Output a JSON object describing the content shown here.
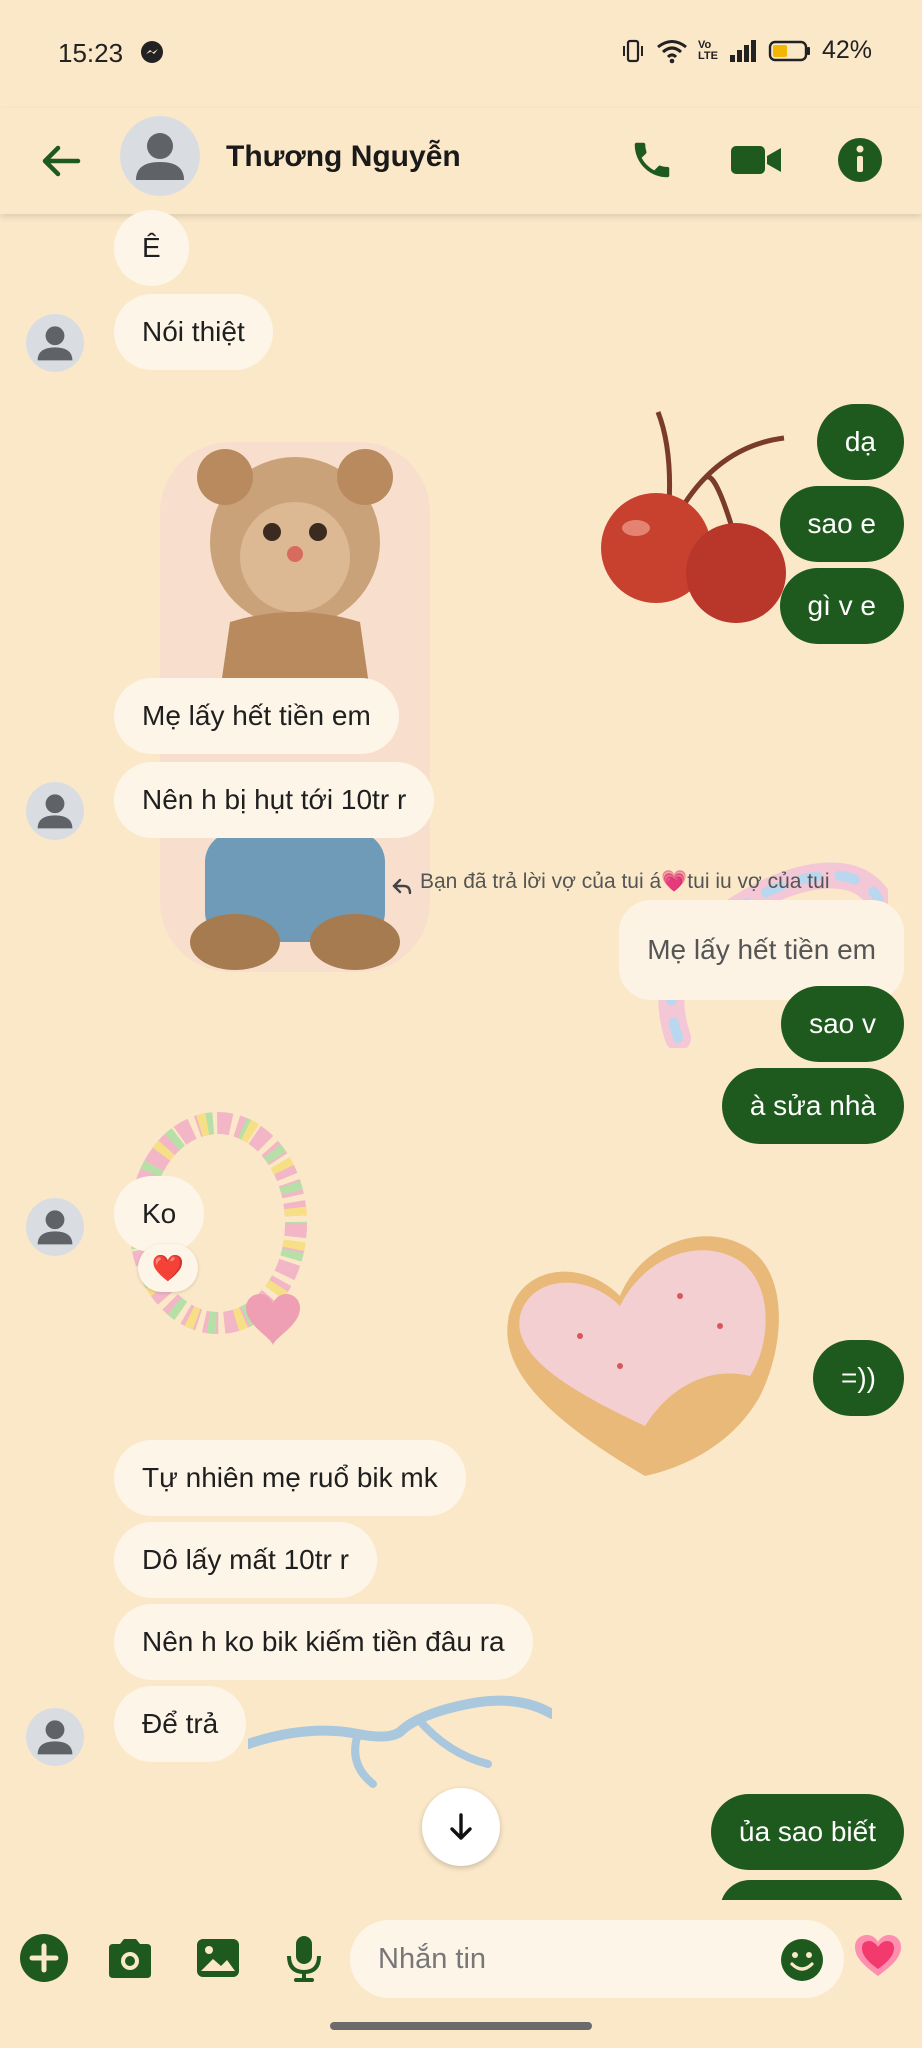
{
  "status_bar": {
    "time": "15:23",
    "battery": "42%",
    "network_label": "Vo LTE"
  },
  "header": {
    "contact_name": "Thương Nguyễn"
  },
  "messages": {
    "m1": "Ê",
    "m2": "Nói thiệt",
    "m3": "dạ",
    "m4": "sao e",
    "m5": "gì v e",
    "m6": "Mẹ lấy hết tiền em",
    "m7": "Nên h bị hụt tới 10tr r",
    "reply_note": "Bạn đã trả lời vợ của tui á💗tui iu vợ của tui",
    "quoted": "Mẹ lấy hết tiền em",
    "m8": "sao v",
    "m9": "à sửa nhà",
    "m10": "Ko",
    "reaction": "❤️",
    "m11": "=))",
    "m12": "Tự nhiên mẹ ruổ bik mk",
    "m13": "Dô lấy mất 10tr r",
    "m14": "Nên h ko bik kiếm tiền đâu ra",
    "m15": "Để trả",
    "m16": "ủa sao biết"
  },
  "composer": {
    "placeholder": "Nhắn tin"
  },
  "colors": {
    "background": "#fbe8c8",
    "outgoing": "#1e5a1e",
    "incoming": "#fdf5e8",
    "accent": "#1e5a1e"
  },
  "icons": {
    "back": "arrow-left-icon",
    "call": "phone-icon",
    "video": "video-camera-icon",
    "info": "info-icon",
    "add": "plus-icon",
    "camera": "camera-icon",
    "gallery": "image-icon",
    "mic": "microphone-icon",
    "emoji": "smile-icon",
    "like": "heart-icon",
    "scroll": "arrow-down-icon"
  }
}
